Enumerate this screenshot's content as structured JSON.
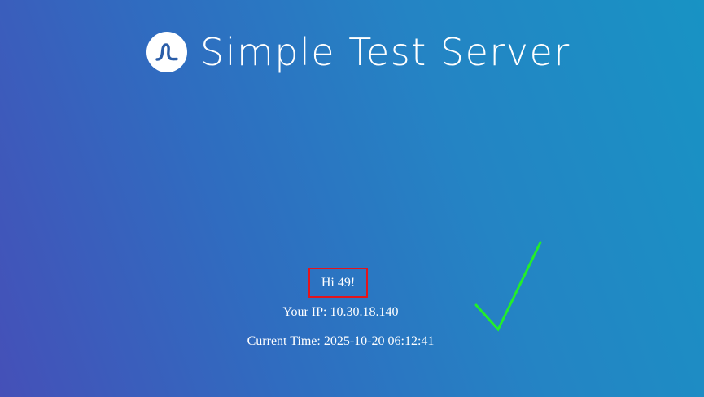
{
  "header": {
    "title": "Simple Test Server",
    "logo_icon": "wave-logo-icon"
  },
  "greeting": {
    "text": "Hi 49!",
    "highlight_color": "#e4141b"
  },
  "info": {
    "ip_line": "Your IP: 10.30.18.140",
    "time_line": "Current Time: 2025-10-20 06:12:41"
  },
  "annotation": {
    "icon": "checkmark-icon",
    "color": "#22ee2a"
  },
  "colors": {
    "background_start": "#4550b8",
    "background_end": "#1893c4",
    "text": "#ffffff"
  }
}
